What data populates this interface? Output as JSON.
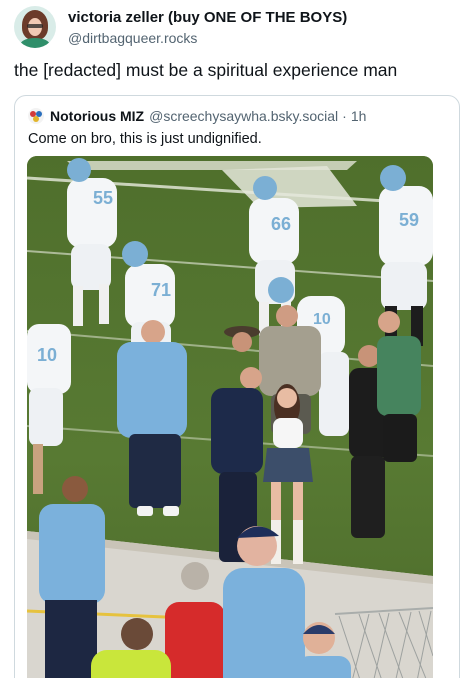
{
  "post": {
    "display_name": "victoria zeller (buy ONE OF THE BOYS)",
    "handle": "@dirtbagqueer.rocks",
    "text": "the [redacted] must be a spiritual experience man"
  },
  "quote": {
    "display_name": "Notorious MIZ",
    "handle": "@screechysaywha.bsky.social",
    "separator": "·",
    "time": "1h",
    "text": "Come on bro, this is just undignified."
  },
  "photo": {
    "jersey_numbers": [
      "55",
      "66",
      "59",
      "71",
      "10",
      "10"
    ]
  },
  "colors": {
    "text_primary": "#0f1419",
    "text_secondary": "#536471",
    "border": "#cfd9de",
    "turf": "#5c7a3a",
    "carolina_blue": "#7bafd4"
  }
}
